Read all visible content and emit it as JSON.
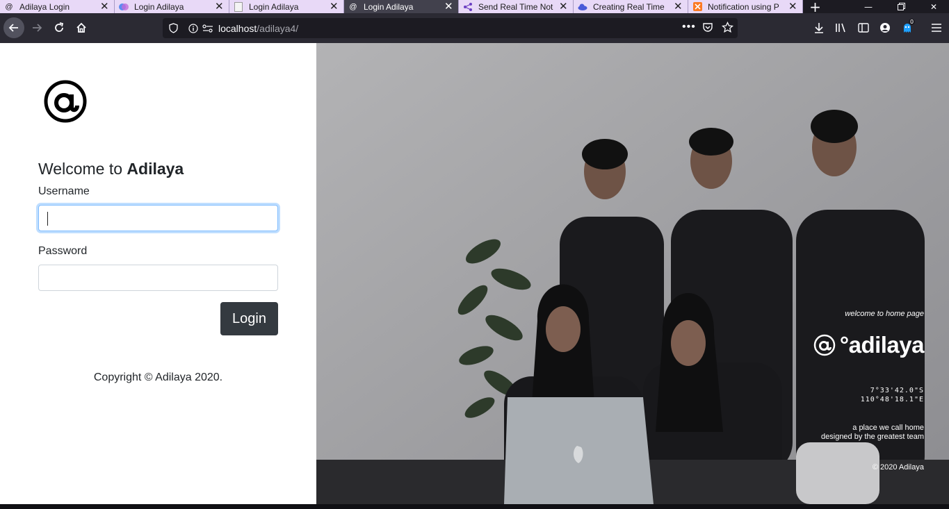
{
  "browser": {
    "tabs": [
      {
        "title": "Adilaya Login",
        "favicon": "adilaya-at-icon",
        "active": false
      },
      {
        "title": "Login Adilaya",
        "favicon": "colorful-app-icon",
        "active": false
      },
      {
        "title": "Login Adilaya",
        "favicon": "blank-page-icon",
        "active": false
      },
      {
        "title": "Login Adilaya",
        "favicon": "adilaya-at-icon",
        "active": true
      },
      {
        "title": "Send Real Time Not",
        "favicon": "share-nodes-icon",
        "active": false
      },
      {
        "title": "Creating Real Time",
        "favicon": "cloud-icon",
        "active": false
      },
      {
        "title": "Notification using P",
        "favicon": "xampp-icon",
        "active": false
      }
    ],
    "url": {
      "host": "localhost",
      "path": "/adilaya4/"
    },
    "notification_badge": "0"
  },
  "login": {
    "welcome_prefix": "Welcome to ",
    "welcome_brand": "Adilaya",
    "username_label": "Username",
    "username_value": "",
    "password_label": "Password",
    "password_value": "",
    "login_button": "Login",
    "copyright": "Copyright © Adilaya 2020."
  },
  "hero": {
    "welcome_text": "welcome to home page",
    "brand": "°adilaya",
    "coords_lat": "7°33'42.0\"S",
    "coords_lon": "110°48'18.1\"E",
    "tagline_1": "a place we call home",
    "tagline_2": "designed by the greatest team",
    "copyright": "© 2020 Adilaya"
  },
  "colors": {
    "button_dark": "#343a40",
    "focus_border": "#80bdff",
    "active_tab": "#42414d",
    "inactive_tab": "#e8d9f7"
  }
}
